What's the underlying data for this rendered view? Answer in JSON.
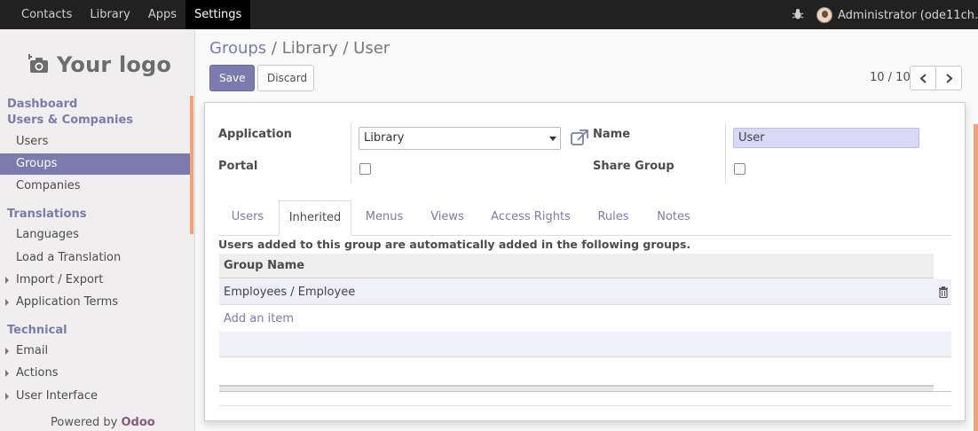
{
  "topbar": {
    "menus": [
      "Contacts",
      "Library",
      "Apps",
      "Settings"
    ],
    "active_menu": "Settings",
    "user_name": "Administrator (ode11ch..."
  },
  "sidebar": {
    "logo_text": "Your logo",
    "sections": [
      {
        "title": "Dashboard"
      },
      {
        "title": "Users & Companies"
      },
      {
        "title": "Translations"
      },
      {
        "title": "Technical"
      }
    ],
    "items": [
      "Users",
      "Groups",
      "Companies",
      "Languages",
      "Load a Translation",
      "Import / Export",
      "Application Terms",
      "Email",
      "Actions",
      "User Interface"
    ],
    "active_item": "Groups",
    "powered_by": "Powered by",
    "brand": "Odoo"
  },
  "control": {
    "breadcrumb_root": "Groups",
    "breadcrumb_sep": "/",
    "breadcrumb_current": "Library / User",
    "save_label": "Save",
    "discard_label": "Discard",
    "pager_text": "10 / 10"
  },
  "form": {
    "application_label": "Application",
    "application_value": "Library",
    "name_label": "Name",
    "name_value": "User",
    "portal_label": "Portal",
    "portal_checked": false,
    "share_group_label": "Share Group",
    "share_group_checked": false
  },
  "tabs": [
    "Users",
    "Inherited",
    "Menus",
    "Views",
    "Access Rights",
    "Rules",
    "Notes"
  ],
  "active_tab": "Inherited",
  "inherited": {
    "info": "Users added to this group are automatically added in the following groups.",
    "column": "Group Name",
    "rows": [
      "Employees / Employee"
    ],
    "add_item": "Add an item"
  }
}
